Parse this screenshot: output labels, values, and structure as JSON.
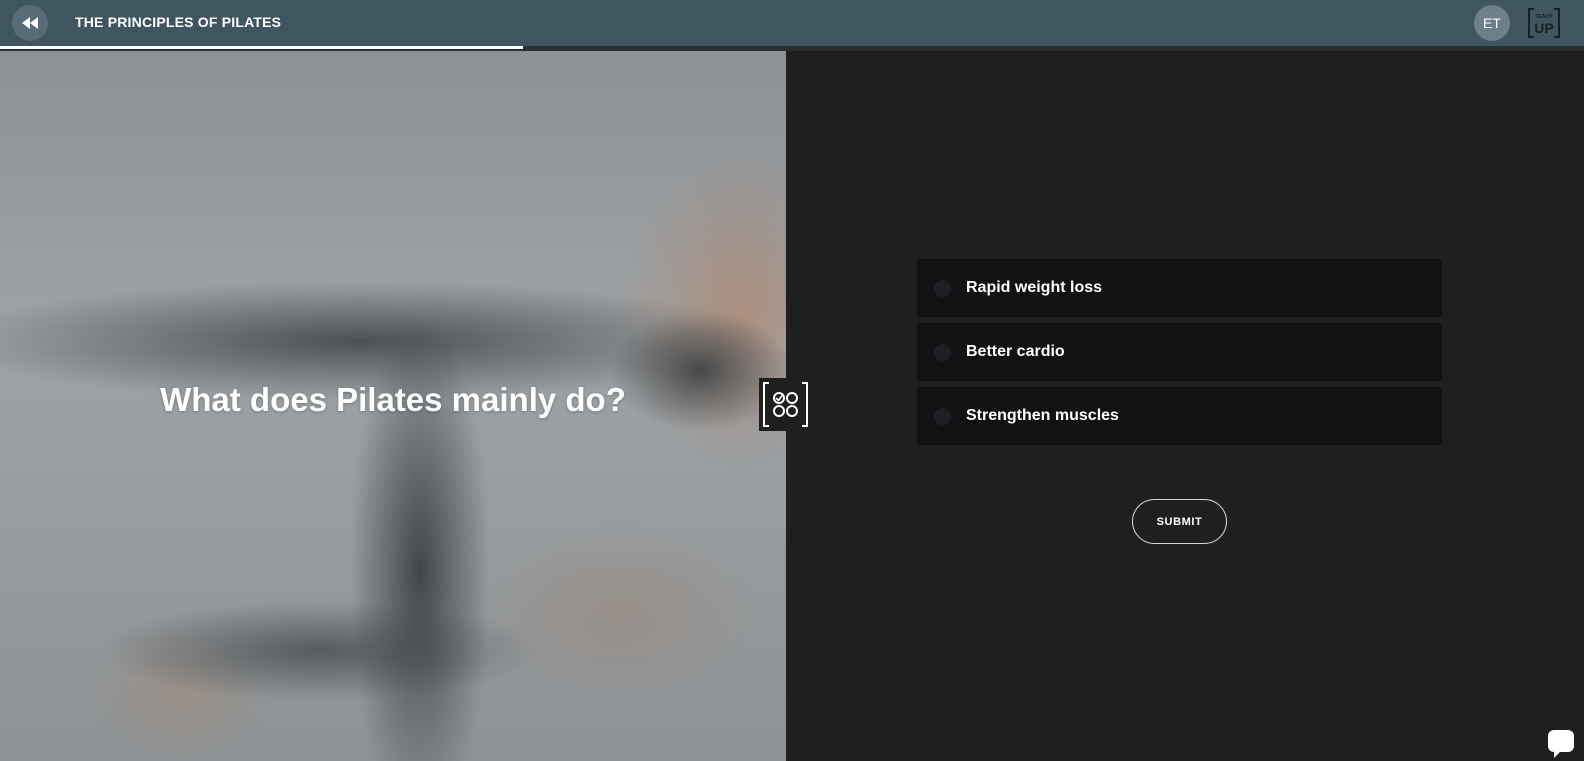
{
  "header": {
    "course_title": "THE PRINCIPLES OF PILATES",
    "user_initials": "ET",
    "progress_percent": 33,
    "back_icon": "rewind-icon",
    "logo_text_top": "TEACH",
    "logo_text_bottom": "UP"
  },
  "question": {
    "text": "What does Pilates mainly do?",
    "badge_icon": "quiz-icon"
  },
  "options": [
    {
      "label": "Rapid weight loss"
    },
    {
      "label": "Better cardio"
    },
    {
      "label": "Strengthen muscles"
    }
  ],
  "actions": {
    "submit_label": "SUBMIT"
  },
  "colors": {
    "header_bg": "#3f5560",
    "panel_bg": "#1f1f1f",
    "option_bg": "#111214",
    "accent": "#ffffff"
  }
}
